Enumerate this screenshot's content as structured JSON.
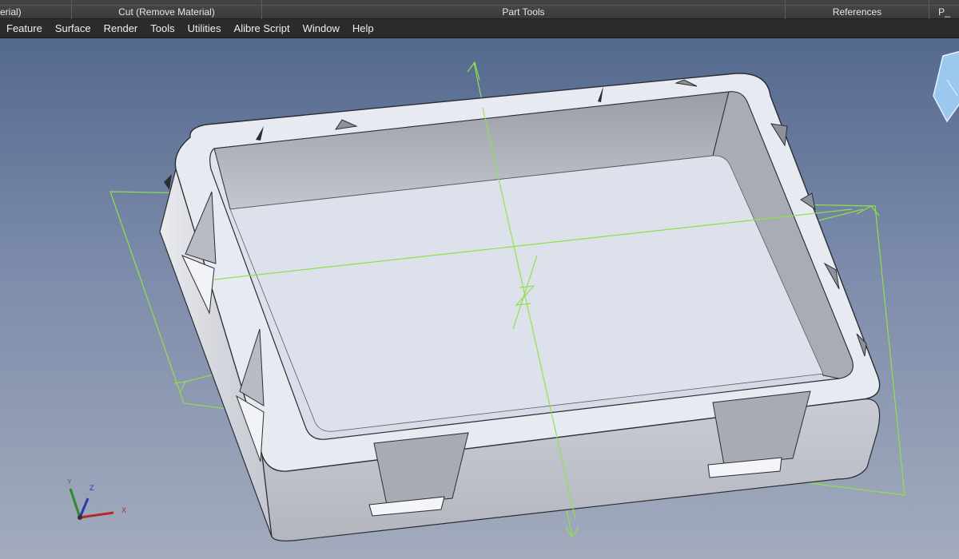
{
  "ribbon": {
    "groups": [
      {
        "label": "erial)"
      },
      {
        "label": "Cut (Remove Material)"
      },
      {
        "label": "Part Tools"
      },
      {
        "label": "References"
      },
      {
        "label": "P_"
      }
    ]
  },
  "menubar": {
    "items": [
      "Feature",
      "Surface",
      "Render",
      "Tools",
      "Utilities",
      "Alibre Script",
      "Window",
      "Help"
    ]
  },
  "viewport": {
    "axis_triad": {
      "x_label": "X",
      "y_label": "Y",
      "z_label": "Z"
    },
    "colors": {
      "sketch_plane": "#8fe04a",
      "part_face_light": "#dfe3ef",
      "part_face_mid": "#cfd3de",
      "part_face_dark": "#a5a9b3",
      "view_cube": "#9cc7ee",
      "x_axis": "#b22a2a",
      "y_axis": "#2e8a2e",
      "z_axis": "#2b3aa8"
    }
  }
}
